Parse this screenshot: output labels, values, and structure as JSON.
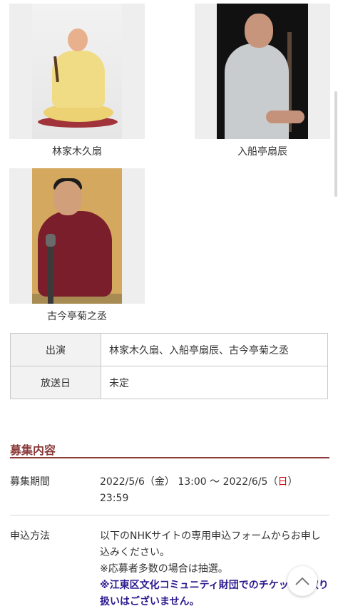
{
  "performers": [
    {
      "name": "林家木久扇",
      "photo": "performer-photo"
    },
    {
      "name": "入船亭扇辰",
      "photo": "performer-photo"
    },
    {
      "name": "古今亭菊之丞",
      "photo": "performer-photo"
    }
  ],
  "info_table": {
    "rows": [
      {
        "label": "出演",
        "value": "林家木久扇、入船亭扇辰、古今亭菊之丞"
      },
      {
        "label": "放送日",
        "value": "未定"
      }
    ]
  },
  "recruitment": {
    "title": "募集内容",
    "period": {
      "label": "募集期間",
      "value_part1": "2022/5/6（金） 13:00 ～ 2022/6/5（",
      "value_sun": "日",
      "value_part2": "）",
      "value_line2": "23:59"
    },
    "method": {
      "label": "申込方法",
      "line1": "以下のNHKサイトの専用申込フォームからお申し込みください。",
      "line2": "※応募者多数の場合は抽選。",
      "notice": "※江東区文化コミュニティ財団でのチケットの取り扱いはございません。"
    }
  },
  "icons": {
    "scroll_top": "chevron-up-icon"
  },
  "colors": {
    "accent": "#8b3a3a",
    "notice": "#2b1b8f",
    "sunday": "#d40000"
  }
}
